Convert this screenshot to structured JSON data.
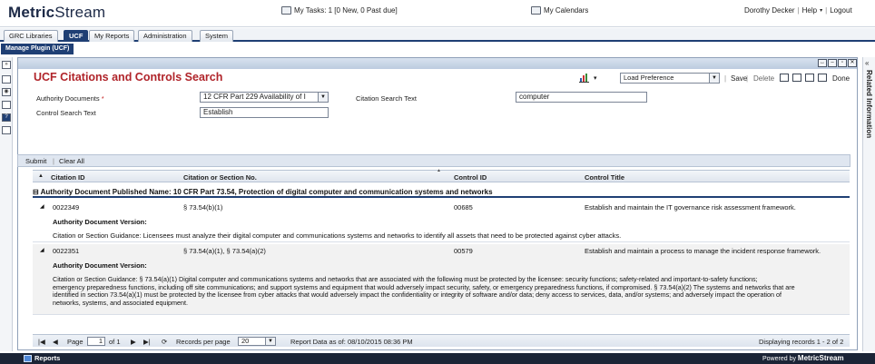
{
  "header": {
    "logo_bold": "Metric",
    "logo_rest": "Stream",
    "tasks": "My Tasks: 1 [0 New, 0 Past due]",
    "calendars": "My Calendars",
    "user": "Dorothy Decker",
    "help": "Help",
    "logout": "Logout"
  },
  "tabs": [
    "GRC Libraries",
    "UCF",
    "My Reports",
    "Administration",
    "System"
  ],
  "active_tab": "UCF",
  "subtab": "Manage Plugin (UCF)",
  "page_title": "UCF Citations and Controls Search",
  "toolbar": {
    "load_preference": "Load Preference",
    "save": "Save",
    "delete": "Delete",
    "done": "Done"
  },
  "form": {
    "authority_label": "Authority Documents",
    "authority_value": "12 CFR Part 229 Availability of I",
    "citation_label": "Citation Search Text",
    "citation_value": "computer",
    "control_label": "Control Search Text",
    "control_value": "Establish",
    "submit": "Submit",
    "clear_all": "Clear All"
  },
  "grid": {
    "columns": [
      "Citation ID",
      "Citation or Section No.",
      "Control ID",
      "Control Title"
    ],
    "group_label": "Authority Document Published Name: 10 CFR Part 73.54, Protection of digital computer and communication systems and networks",
    "rows": [
      {
        "citation_id": "0022349",
        "section": "§ 73.54(b)(1)",
        "control_id": "00685",
        "control_title": "Establish and maintain the IT governance risk assessment framework.",
        "version_label": "Authority Document Version:",
        "guidance": "Citation or Section Guidance: Licensees must analyze their digital computer and communications systems and networks to identify all assets that need to be protected against cyber attacks."
      },
      {
        "citation_id": "0022351",
        "section": "§ 73.54(a)(1), § 73.54(a)(2)",
        "control_id": "00579",
        "control_title": "Establish and maintain a process to manage the incident response framework.",
        "version_label": "Authority Document Version:",
        "guidance_lines": [
          "Citation or Section Guidance: § 73.54(a)(1) Digital computer and communications systems and networks that are associated with the following must be protected by the licensee: security functions; safety-related and important-to-safety functions;",
          "emergency preparedness functions, including off site communications; and support systems and equipment that would adversely impact security, safety, or emergency preparedness functions, if compromised. § 73.54(a)(2) The systems and networks that are",
          "identified in section 73.54(a)(1) must be protected by the licensee from cyber attacks that would adversely impact the confidentiality or integrity of software and/or data; deny access to services, data, and/or systems; and adversely impact the operation of",
          "networks, systems, and associated equipment."
        ]
      }
    ]
  },
  "pager": {
    "page_label": "Page",
    "page_value": "1",
    "of_label": "of 1",
    "records_label": "Records per page",
    "records_value": "20",
    "report_data": "Report Data as of: 08/10/2015 08:36 PM",
    "displaying": "Displaying records 1 - 2 of 2"
  },
  "right_panel": "Related Information",
  "footer": {
    "reports": "Reports",
    "powered_prefix": "Powered by ",
    "powered_brand": "MetricStream"
  }
}
